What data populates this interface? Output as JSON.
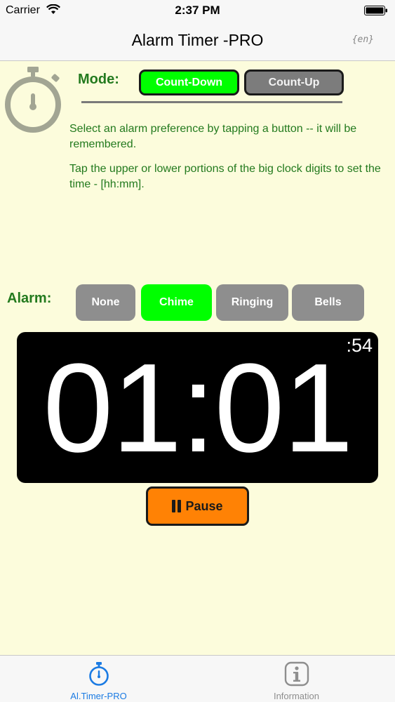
{
  "status_bar": {
    "carrier": "Carrier",
    "time": "2:37 PM",
    "wifi_icon": "wifi-icon",
    "battery_icon": "battery-icon"
  },
  "nav": {
    "title": "Alarm Timer -PRO",
    "lang": "{en}"
  },
  "logo_icon": "stopwatch-icon",
  "mode": {
    "label": "Mode:",
    "count_down": "Count-Down",
    "count_up": "Count-Up",
    "selected": "Count-Down"
  },
  "instructions": {
    "line1": "Select an alarm preference by tapping a button -- it will be remembered.",
    "line2": "Tap the upper or lower portions of the big clock digits to set the time - [hh:mm]."
  },
  "alarm": {
    "label": "Alarm:",
    "options": [
      "None",
      "Chime",
      "Ringing",
      "Bells"
    ],
    "selected": "Chime"
  },
  "clock": {
    "time": "01:01",
    "seconds": ":54"
  },
  "pause_button": {
    "label": "Pause",
    "icon": "pause-icon"
  },
  "tab_bar": {
    "tabs": [
      {
        "label": "Al.Timer-PRO",
        "icon": "stopwatch-icon",
        "active": true
      },
      {
        "label": "Information",
        "icon": "info-icon",
        "active": false
      }
    ]
  },
  "colors": {
    "background": "#fcfcdc",
    "green_text": "#237a1e",
    "selected_green": "#00ff00",
    "pause_orange": "#ff8205",
    "tab_active": "#1b7be3"
  }
}
